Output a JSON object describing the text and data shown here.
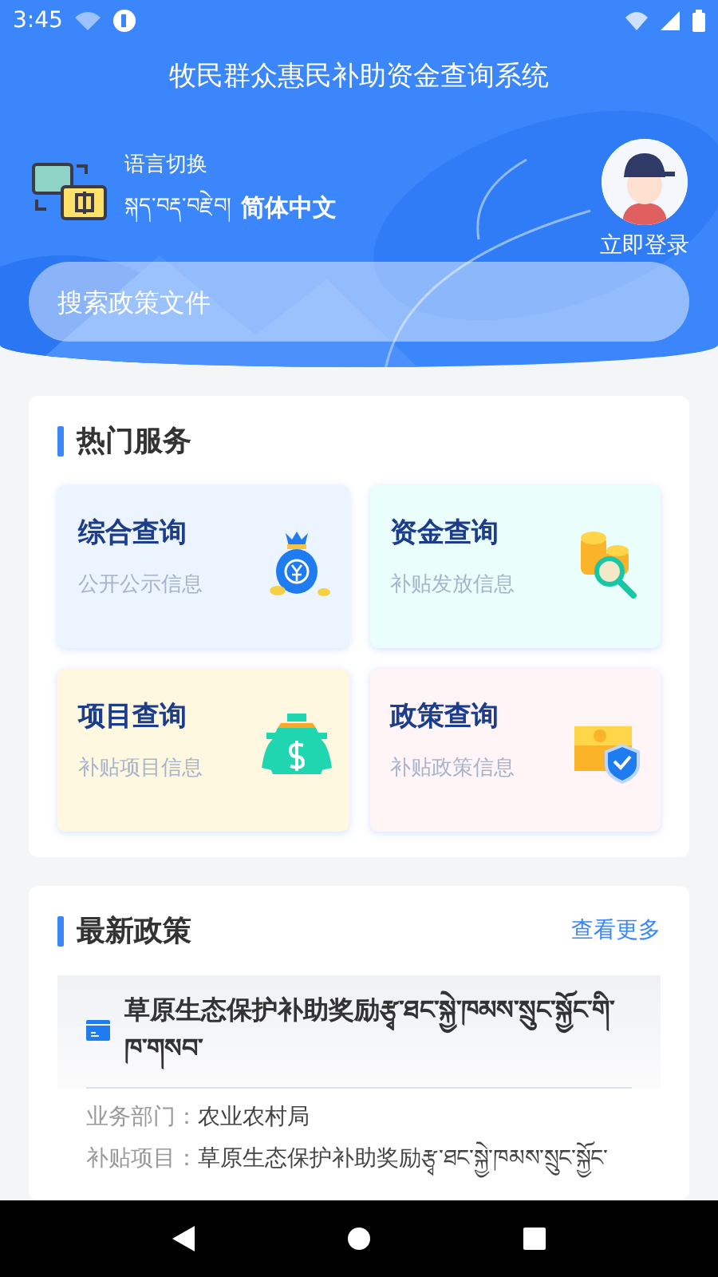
{
  "status_bar": {
    "time": "3:45"
  },
  "header": {
    "title": "牧民群众惠民补助资金查询系统",
    "language": {
      "label": "语言切换",
      "label_tibetan": "སྐད་བརྡ་བརྗེ་བ།",
      "current": "简体中文"
    },
    "login": "立即登录",
    "search": {
      "placeholder": "搜索政策文件"
    }
  },
  "services": {
    "title": "热门服务",
    "items": [
      {
        "title": "综合查询",
        "subtitle": "公开公示信息",
        "kind": "moneybag"
      },
      {
        "title": "资金查询",
        "subtitle": "补贴发放信息",
        "kind": "coins"
      },
      {
        "title": "项目查询",
        "subtitle": "补贴项目信息",
        "kind": "cashbag"
      },
      {
        "title": "政策查询",
        "subtitle": "补贴政策信息",
        "kind": "cash"
      }
    ]
  },
  "latest": {
    "title": "最新政策",
    "more": "查看更多",
    "policies": [
      {
        "title": "草原生态保护补助奖励རྩྭ་ཐང་སྐྱེ་ཁམས་སྲུང་སྐྱོང་གི་ཁ་གསབ་",
        "fields": [
          {
            "label": "业务部门：",
            "value": "农业农村局"
          },
          {
            "label": "补贴项目：",
            "value": "草原生态保护补助奖励རྩྭ་ཐང་སྐྱེ་ཁམས་སྲུང་སྐྱོང་"
          }
        ]
      }
    ]
  }
}
